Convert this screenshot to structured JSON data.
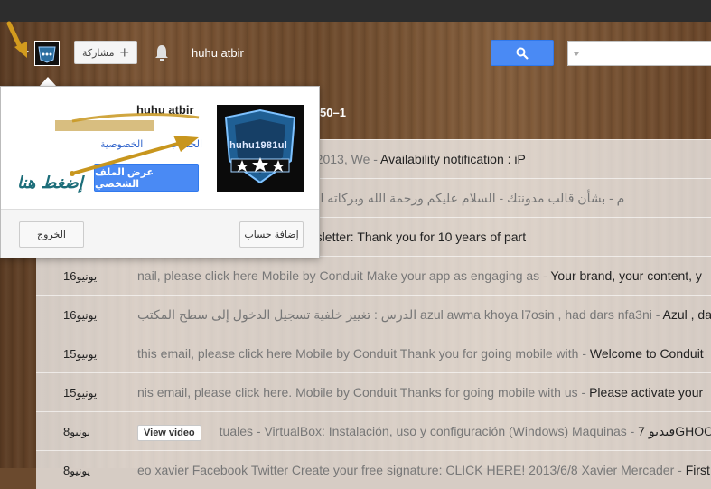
{
  "header": {
    "share_label": "مشاركة",
    "share_plus": "+",
    "username": "huhu atbir",
    "search_placeholder": ""
  },
  "list": {
    "pagination": "50–1",
    "rows": [
      {
        "date_day": "",
        "date_month": "",
        "prefix": "on made on RefurbMe at 18/06/2013, We - ",
        "subject": "Availability notification : iP",
        "video": ""
      },
      {
        "date_day": "",
        "date_month": "",
        "prefix": "م - بشأن قالب مدونتك - السلام عليكم ورحمة الله وبركاته الأخ الكريم / مدونة حوحو للمعلومات",
        "subject": "",
        "video": ""
      },
      {
        "date_day": "",
        "date_month": "",
        "prefix": "e of partnership - ",
        "subject": "AdSense Newsletter: Thank you for 10 years of part",
        "video": ""
      },
      {
        "date_day": "16",
        "date_month": "يونيو",
        "prefix": "nail, please click here Mobile by Conduit Make your app as engaging as - ",
        "subject": "Your brand, your content, y",
        "video": ""
      },
      {
        "date_day": "16",
        "date_month": "يونيو",
        "prefix": "الدرس : تغيير خلفية تسجيل الدخول إلى سطح المكتب azul awma khoya l7osin , had dars nfa3ni - ",
        "subject": "Azul , darori trad ass",
        "video": ""
      },
      {
        "date_day": "15",
        "date_month": "يونيو",
        "prefix": "this email, please click here Mobile by Conduit Thank you for going mobile with - ",
        "subject": "Welcome to Conduit",
        "video": ""
      },
      {
        "date_day": "15",
        "date_month": "يونيو",
        "prefix": "nis email, please click here. Mobile by Conduit Thanks for going mobile with us - ",
        "subject": "Please activate your",
        "video": ""
      },
      {
        "date_day": "8",
        "date_month": "يونيو",
        "prefix": "tuales - VirtualBox: Instalación, uso y configuración (Windows) Maquinas - ",
        "subject": "فيديو 7GHOO",
        "video": "View video"
      },
      {
        "date_day": "8",
        "date_month": "يونيو",
        "prefix": "eo xavier Facebook Twitter Create your free signature: CLICK HERE! 2013/6/8 Xavier Mercader - ",
        "subject": "First",
        "video": ""
      }
    ]
  },
  "popup": {
    "name": "huhu atbir",
    "privacy_link": "الخصوصية",
    "account_link": "الحساب",
    "view_profile": "عرض الملف الشخصي",
    "hint": "إضغط هنا",
    "avatar_nick": "huhu1981ul",
    "logout": "الخروج",
    "add_account": "إضافة حساب"
  },
  "colors": {
    "accent_blue": "#4a8af4",
    "link_blue": "#3366cc",
    "annotation_gold": "#c8961e"
  }
}
